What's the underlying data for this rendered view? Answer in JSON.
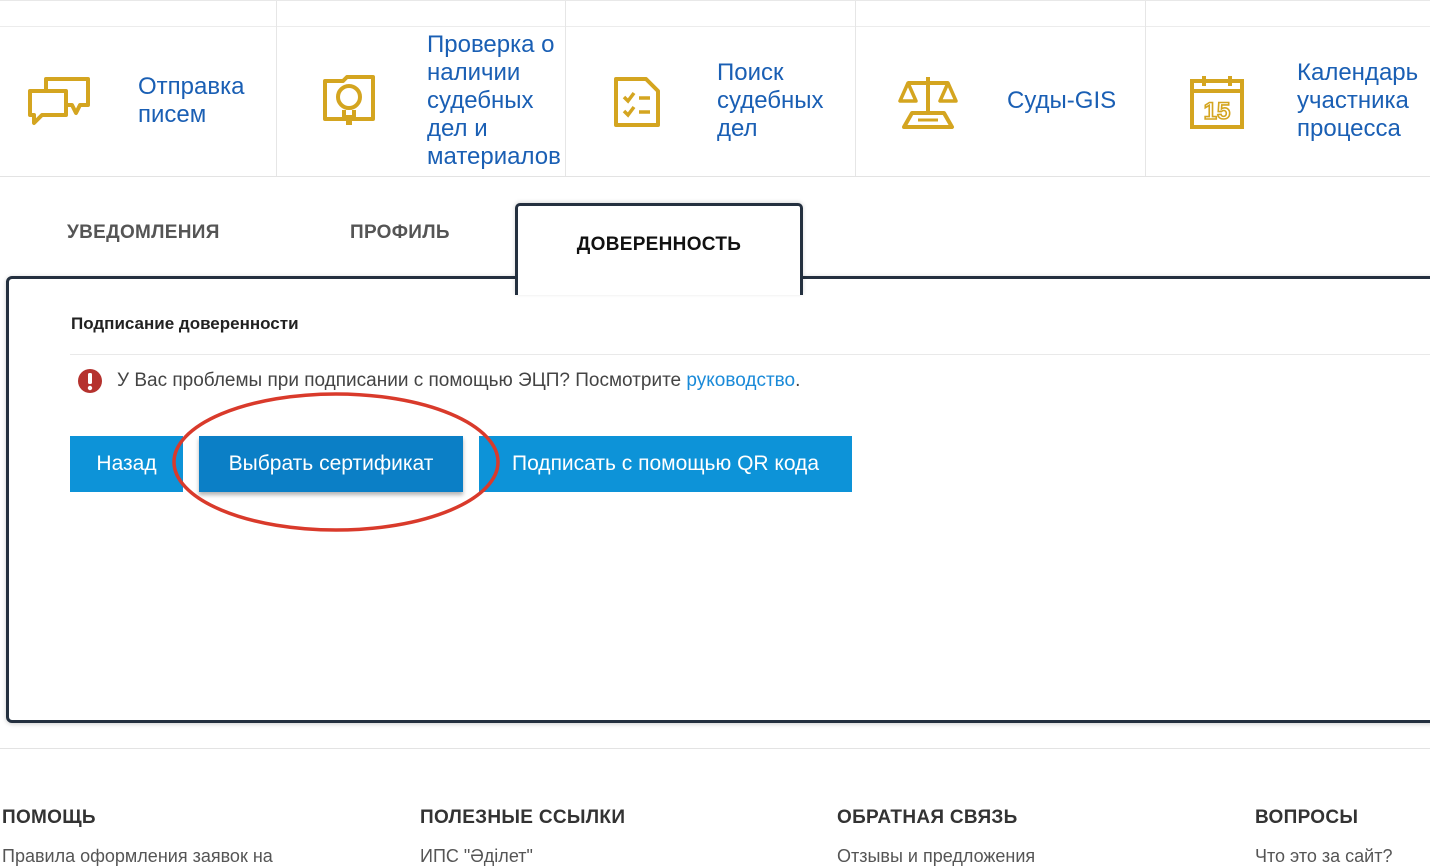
{
  "services": [
    {
      "label": "Отправка\nписем",
      "icon": "chat-bubbles-icon"
    },
    {
      "label": "Проверка о\nналичии\nсудебных\nдел и\nматериалов",
      "icon": "search-document-icon"
    },
    {
      "label": "Поиск\nсудебных\nдел",
      "icon": "checklist-icon"
    },
    {
      "label": "Суды-GIS",
      "icon": "scales-icon"
    },
    {
      "label": "Календарь\nучастника\nпроцесса",
      "icon": "calendar-icon",
      "icon_text": "15"
    }
  ],
  "tabs": {
    "notifications": "УВЕДОМЛЕНИЯ",
    "profile": "ПРОФИЛЬ",
    "power_of_attorney": "ДОВЕРЕННОСТЬ"
  },
  "panel": {
    "title": "Подписание доверенности",
    "alert_text": "У Вас проблемы при подписании с помощью ЭЦП? Посмотрите ",
    "alert_link": "руководство",
    "alert_end": ".",
    "buttons": {
      "back": "Назад",
      "choose_cert": "Выбрать сертификат",
      "sign_qr": "Подписать с помощью QR кода"
    }
  },
  "footer": {
    "help": {
      "heading": "ПОМОЩЬ",
      "first_link": "Правила оформления заявок на"
    },
    "links": {
      "heading": "ПОЛЕЗНЫЕ ССЫЛКИ",
      "first_link": "ИПС \"Әділет\""
    },
    "feedback": {
      "heading": "ОБРАТНАЯ СВЯЗЬ",
      "first_link": "Отзывы и предложения"
    },
    "questions": {
      "heading": "ВОПРОСЫ",
      "first_link": "Что это за сайт?"
    }
  },
  "colors": {
    "gold": "#d4a520",
    "link_blue": "#1a5fb4",
    "button_blue": "#0d93d8",
    "panel_border": "#24303f",
    "alert_red": "#b5322e",
    "annotation_red": "#d93a2b"
  }
}
